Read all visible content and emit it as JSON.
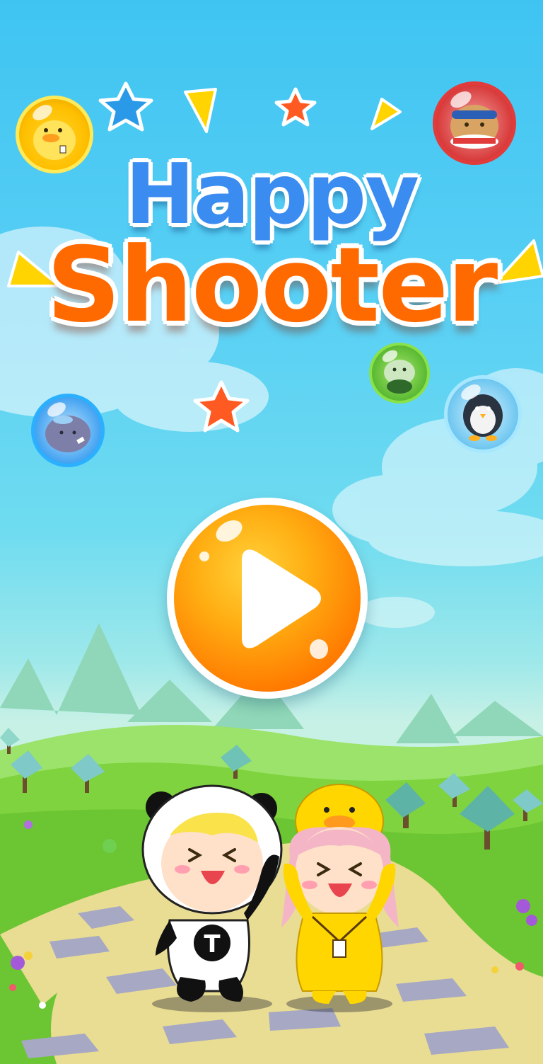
{
  "game": {
    "title_line1": "Happy",
    "title_line2": "Shooter"
  },
  "characters": {
    "panda_shirt_letter": "T"
  },
  "icons": {
    "play": "play-icon",
    "stars": "star-icon",
    "triangles": "confetti-triangle-icon",
    "bubbles": [
      "duck-bubble-icon",
      "bear-bubble-icon",
      "frog-bubble-icon",
      "penguin-bubble-icon",
      "blob-bubble-icon"
    ]
  },
  "colors": {
    "sky_top": "#3fc4f2",
    "title_happy": "#3b8cf0",
    "title_shooter": "#ff6a00",
    "play_button": "#ff8a00",
    "grass": "#7ed23a",
    "path": "#e8d98a"
  }
}
